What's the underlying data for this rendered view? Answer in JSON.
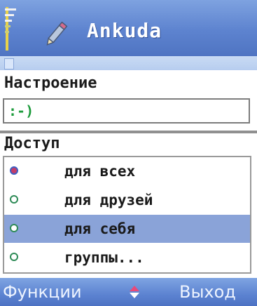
{
  "app": {
    "title": "Ankuda",
    "icon": "pencil-icon",
    "signal_icon": "signal-strength-icon"
  },
  "mood": {
    "label": "Настроение",
    "value": ":-)"
  },
  "access": {
    "label": "Доступ",
    "options": [
      {
        "label": "для всех",
        "checked": true,
        "highlighted": false
      },
      {
        "label": "для друзей",
        "checked": false,
        "highlighted": false
      },
      {
        "label": "для себя",
        "checked": false,
        "highlighted": true
      },
      {
        "label": "группы...",
        "checked": false,
        "highlighted": false
      }
    ]
  },
  "softkeys": {
    "left": "Функции",
    "right": "Выход",
    "center_icon": "up-down-arrows-icon"
  },
  "colors": {
    "bar": "#5d83cf",
    "highlight": "#8aa3d8",
    "mood_text": "#1b9a3a"
  }
}
